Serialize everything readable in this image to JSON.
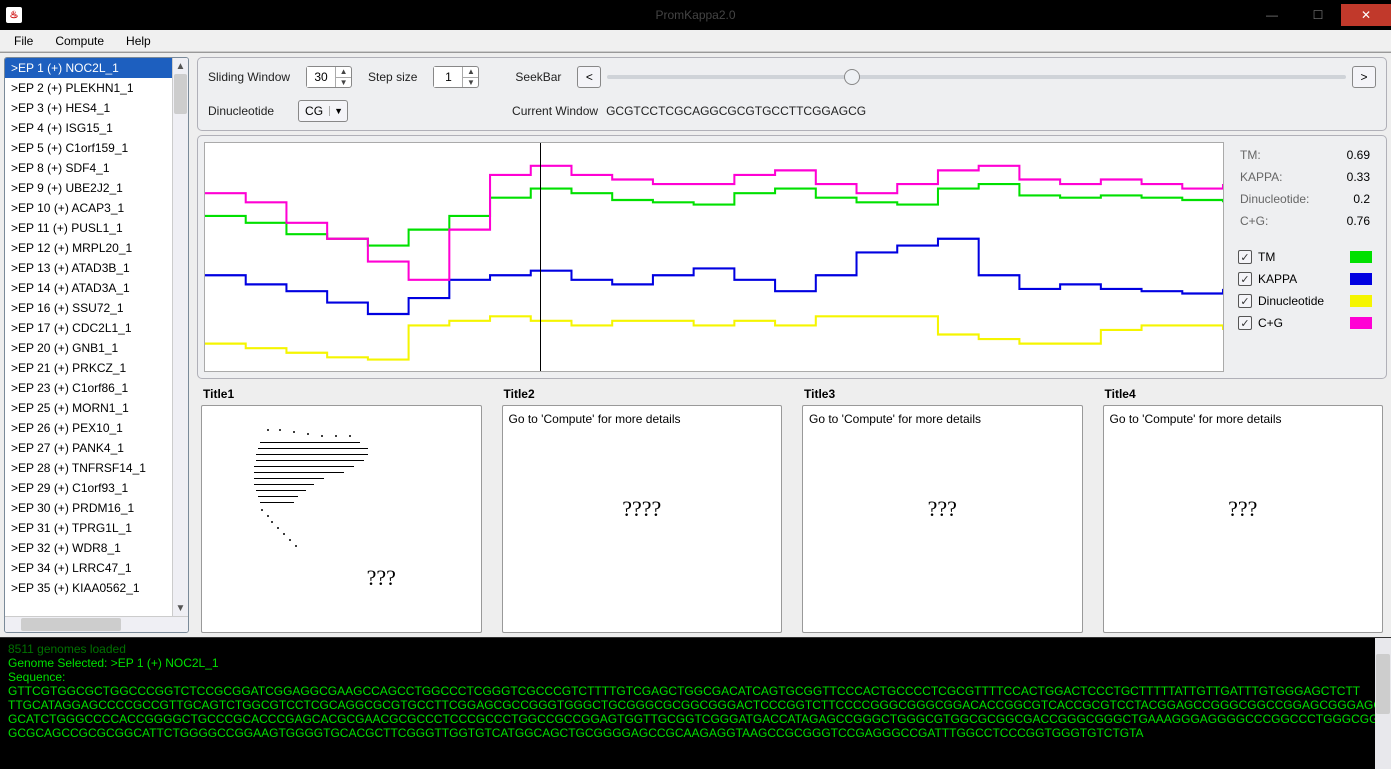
{
  "window": {
    "title": "PromKappa2.0"
  },
  "menu": {
    "file": "File",
    "compute": "Compute",
    "help": "Help"
  },
  "sidebar": {
    "items": [
      ">EP 1 (+) NOC2L_1",
      ">EP 2 (+) PLEKHN1_1",
      ">EP 3 (+) HES4_1",
      ">EP 4 (+) ISG15_1",
      ">EP 5 (+) C1orf159_1",
      ">EP 8 (+) SDF4_1",
      ">EP 9 (+) UBE2J2_1",
      ">EP 10 (+) ACAP3_1",
      ">EP 11 (+) PUSL1_1",
      ">EP 12 (+) MRPL20_1",
      ">EP 13 (+) ATAD3B_1",
      ">EP 14 (+) ATAD3A_1",
      ">EP 16 (+) SSU72_1",
      ">EP 17 (+) CDC2L1_1",
      ">EP 20 (+) GNB1_1",
      ">EP 21 (+) PRKCZ_1",
      ">EP 23 (+) C1orf86_1",
      ">EP 25 (+) MORN1_1",
      ">EP 26 (+) PEX10_1",
      ">EP 27 (+) PANK4_1",
      ">EP 28 (+) TNFRSF14_1",
      ">EP 29 (+) C1orf93_1",
      ">EP 30 (+) PRDM16_1",
      ">EP 31 (+) TPRG1L_1",
      ">EP 32 (+) WDR8_1",
      ">EP 34 (+) LRRC47_1",
      ">EP 35 (+) KIAA0562_1"
    ]
  },
  "controls": {
    "sliding_window_label": "Sliding Window",
    "sliding_window_value": "30",
    "step_size_label": "Step size",
    "step_size_value": "1",
    "seekbar_label": "SeekBar",
    "seekbar_prev": "<",
    "seekbar_next": ">",
    "dinucleotide_label": "Dinucleotide",
    "dinucleotide_value": "CG",
    "current_window_label": "Current Window",
    "current_window_value": "GCGTCCTCGCAGGCGCGTGCCTTCGGAGCG"
  },
  "metrics": {
    "tm_label": "TM:",
    "tm_value": "0.69",
    "kappa_label": "KAPPA:",
    "kappa_value": "0.33",
    "dinuc_label": "Dinucleotide:",
    "dinuc_value": "0.2",
    "cg_label": "C+G:",
    "cg_value": "0.76"
  },
  "legend": {
    "tm": {
      "label": "TM",
      "color": "#00e000"
    },
    "kappa": {
      "label": "KAPPA",
      "color": "#0000e0"
    },
    "dinuc": {
      "label": "Dinucleotide",
      "color": "#f5f500"
    },
    "cg": {
      "label": "C+G",
      "color": "#ff00d4"
    }
  },
  "thumbs": {
    "t1": {
      "title": "Title1",
      "text": "???"
    },
    "t2": {
      "title": "Title2",
      "text": "????",
      "hint": "Go to 'Compute' for more details"
    },
    "t3": {
      "title": "Title3",
      "text": "???",
      "hint": "Go to 'Compute' for more details"
    },
    "t4": {
      "title": "Title4",
      "text": "???",
      "hint": "Go to 'Compute' for more details"
    }
  },
  "console": {
    "line0": "8511 genomes loaded",
    "line1": "Genome Selected: >EP 1 (+) NOC2L_1",
    "line2": "Sequence:",
    "seq1": "GTTCGTGGCGCTGGCCCGGTCTCCGCGGATCGGAGGCGAAGCCAGCCTGGCCCTCGGGTCGCCCGTCTTTTGTCGAGCTGGCGACATCAGTGCGGTTCCCACTGCCCCTCGCGTTTTCCACTGGACTCCCTGCTTTTTATTGTTGATTTGTGGGAGCTCTT",
    "seq2": "TTGCATAGGAGCCCCGCCGTTGCAGTCTGGCGTCCTCGCAGGCGCGTGCCTTCGGAGCGCCGGGTGGGCTGCGGGCGCGGCGGGACTCCCGGTCTTCCCCGGGCGGGCGGACACCGGCGTCACCGCGTCCTACGGAGCCGGGCGGCCGGAGCGGGAGGC",
    "seq3": "GCATCTGGGCCCCACCGGGGCTGCCCGCACCCGAGCACGCGAACGCGCCCTCCCGCCCTGGCCGCCGGAGTGGTTGCGGTCGGGATGACCATAGAGCCGGGCTGGGCGTGGCGCGGCGACCGGGCGGGCTGAAAGGGAGGGGCCCGGCCCTGGGCGGAAGT",
    "seq4": "GCGCAGCCGCGCGGCATTCTGGGGCCGGAAGTGGGGTGCACGCTTCGGGTTGGTGTCATGGCAGCTGCGGGGAGCCGCAAGAGGTAAGCCGCGGGTCCGAGGGCCGATTTGGCCTCCCGGTGGGTGTCTGTA"
  },
  "chart_data": {
    "type": "line",
    "x_range": [
      0,
      1000
    ],
    "y_range": [
      0,
      1
    ],
    "cursor_x": 335,
    "series": [
      {
        "name": "TM",
        "color": "#00e000",
        "approx_values": [
          0.68,
          0.65,
          0.6,
          0.58,
          0.55,
          0.62,
          0.68,
          0.76,
          0.8,
          0.78,
          0.75,
          0.74,
          0.73,
          0.78,
          0.8,
          0.76,
          0.74,
          0.73,
          0.8,
          0.82,
          0.77,
          0.76,
          0.77,
          0.76,
          0.75,
          0.74
        ]
      },
      {
        "name": "KAPPA",
        "color": "#0000e0",
        "approx_values": [
          0.42,
          0.38,
          0.35,
          0.3,
          0.25,
          0.32,
          0.4,
          0.42,
          0.44,
          0.4,
          0.38,
          0.42,
          0.45,
          0.4,
          0.35,
          0.42,
          0.52,
          0.55,
          0.58,
          0.42,
          0.36,
          0.38,
          0.36,
          0.35,
          0.34,
          0.36
        ]
      },
      {
        "name": "Dinucleotide",
        "color": "#f5f500",
        "approx_values": [
          0.12,
          0.1,
          0.08,
          0.06,
          0.05,
          0.2,
          0.22,
          0.24,
          0.22,
          0.2,
          0.22,
          0.22,
          0.2,
          0.22,
          0.2,
          0.24,
          0.24,
          0.24,
          0.16,
          0.14,
          0.12,
          0.12,
          0.18,
          0.2,
          0.2,
          0.18
        ]
      },
      {
        "name": "C+G",
        "color": "#ff00d4",
        "approx_values": [
          0.78,
          0.74,
          0.65,
          0.58,
          0.48,
          0.4,
          0.62,
          0.86,
          0.9,
          0.86,
          0.84,
          0.82,
          0.82,
          0.86,
          0.88,
          0.82,
          0.78,
          0.82,
          0.88,
          0.9,
          0.84,
          0.82,
          0.84,
          0.82,
          0.8,
          0.82
        ]
      }
    ]
  }
}
